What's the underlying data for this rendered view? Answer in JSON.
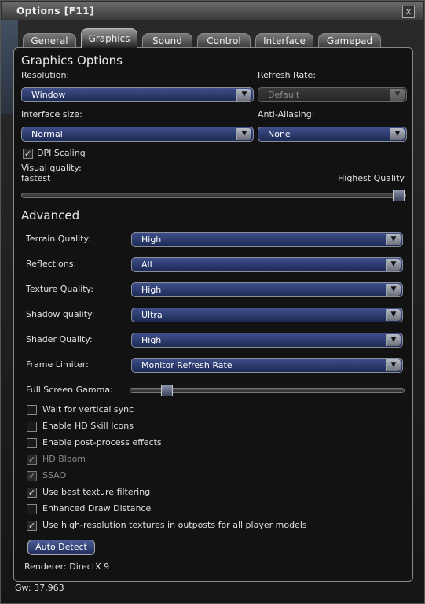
{
  "window": {
    "title": "Options  [F11]",
    "close": "x"
  },
  "tabs": [
    {
      "label": "General"
    },
    {
      "label": "Graphics"
    },
    {
      "label": "Sound"
    },
    {
      "label": "Control"
    },
    {
      "label": "Interface"
    },
    {
      "label": "Gamepad"
    }
  ],
  "graphics": {
    "heading": "Graphics Options",
    "resolution_label": "Resolution:",
    "resolution_value": "Window",
    "refresh_label": "Refresh Rate:",
    "refresh_value": "Default",
    "interface_label": "Interface size:",
    "interface_value": "Normal",
    "aa_label": "Anti-Aliasing:",
    "aa_value": "None",
    "dpi_label": "DPI Scaling",
    "dpi_checked": true,
    "visual_quality_label": "Visual quality:",
    "visual_min": "fastest",
    "visual_max": "Highest Quality",
    "visual_level": 1.0
  },
  "advanced": {
    "heading": "Advanced",
    "rows": [
      {
        "label": "Terrain Quality:",
        "value": "High"
      },
      {
        "label": "Reflections:",
        "value": "All"
      },
      {
        "label": "Texture Quality:",
        "value": "High"
      },
      {
        "label": "Shadow quality:",
        "value": "Ultra"
      },
      {
        "label": "Shader Quality:",
        "value": "High"
      },
      {
        "label": "Frame Limiter:",
        "value": "Monitor Refresh Rate"
      }
    ],
    "gamma_label": "Full Screen Gamma:",
    "gamma_level": 0.12,
    "checks": [
      {
        "label": "Wait for vertical sync",
        "checked": false,
        "disabled": false
      },
      {
        "label": "Enable HD Skill Icons",
        "checked": false,
        "disabled": false
      },
      {
        "label": "Enable post-process effects",
        "checked": false,
        "disabled": false
      },
      {
        "label": "HD Bloom",
        "checked": true,
        "disabled": true
      },
      {
        "label": "SSAO",
        "checked": true,
        "disabled": true
      },
      {
        "label": "Use best texture filtering",
        "checked": true,
        "disabled": false
      },
      {
        "label": "Enhanced Draw Distance",
        "checked": false,
        "disabled": false
      },
      {
        "label": "Use high-resolution textures in outposts for all player models",
        "checked": true,
        "disabled": false
      }
    ],
    "auto_detect": "Auto Detect",
    "renderer": "Renderer: DirectX 9"
  },
  "footer": {
    "gold": "Gw: 37,963"
  },
  "glyphs": {
    "arrow": "▼",
    "check": "✓"
  }
}
